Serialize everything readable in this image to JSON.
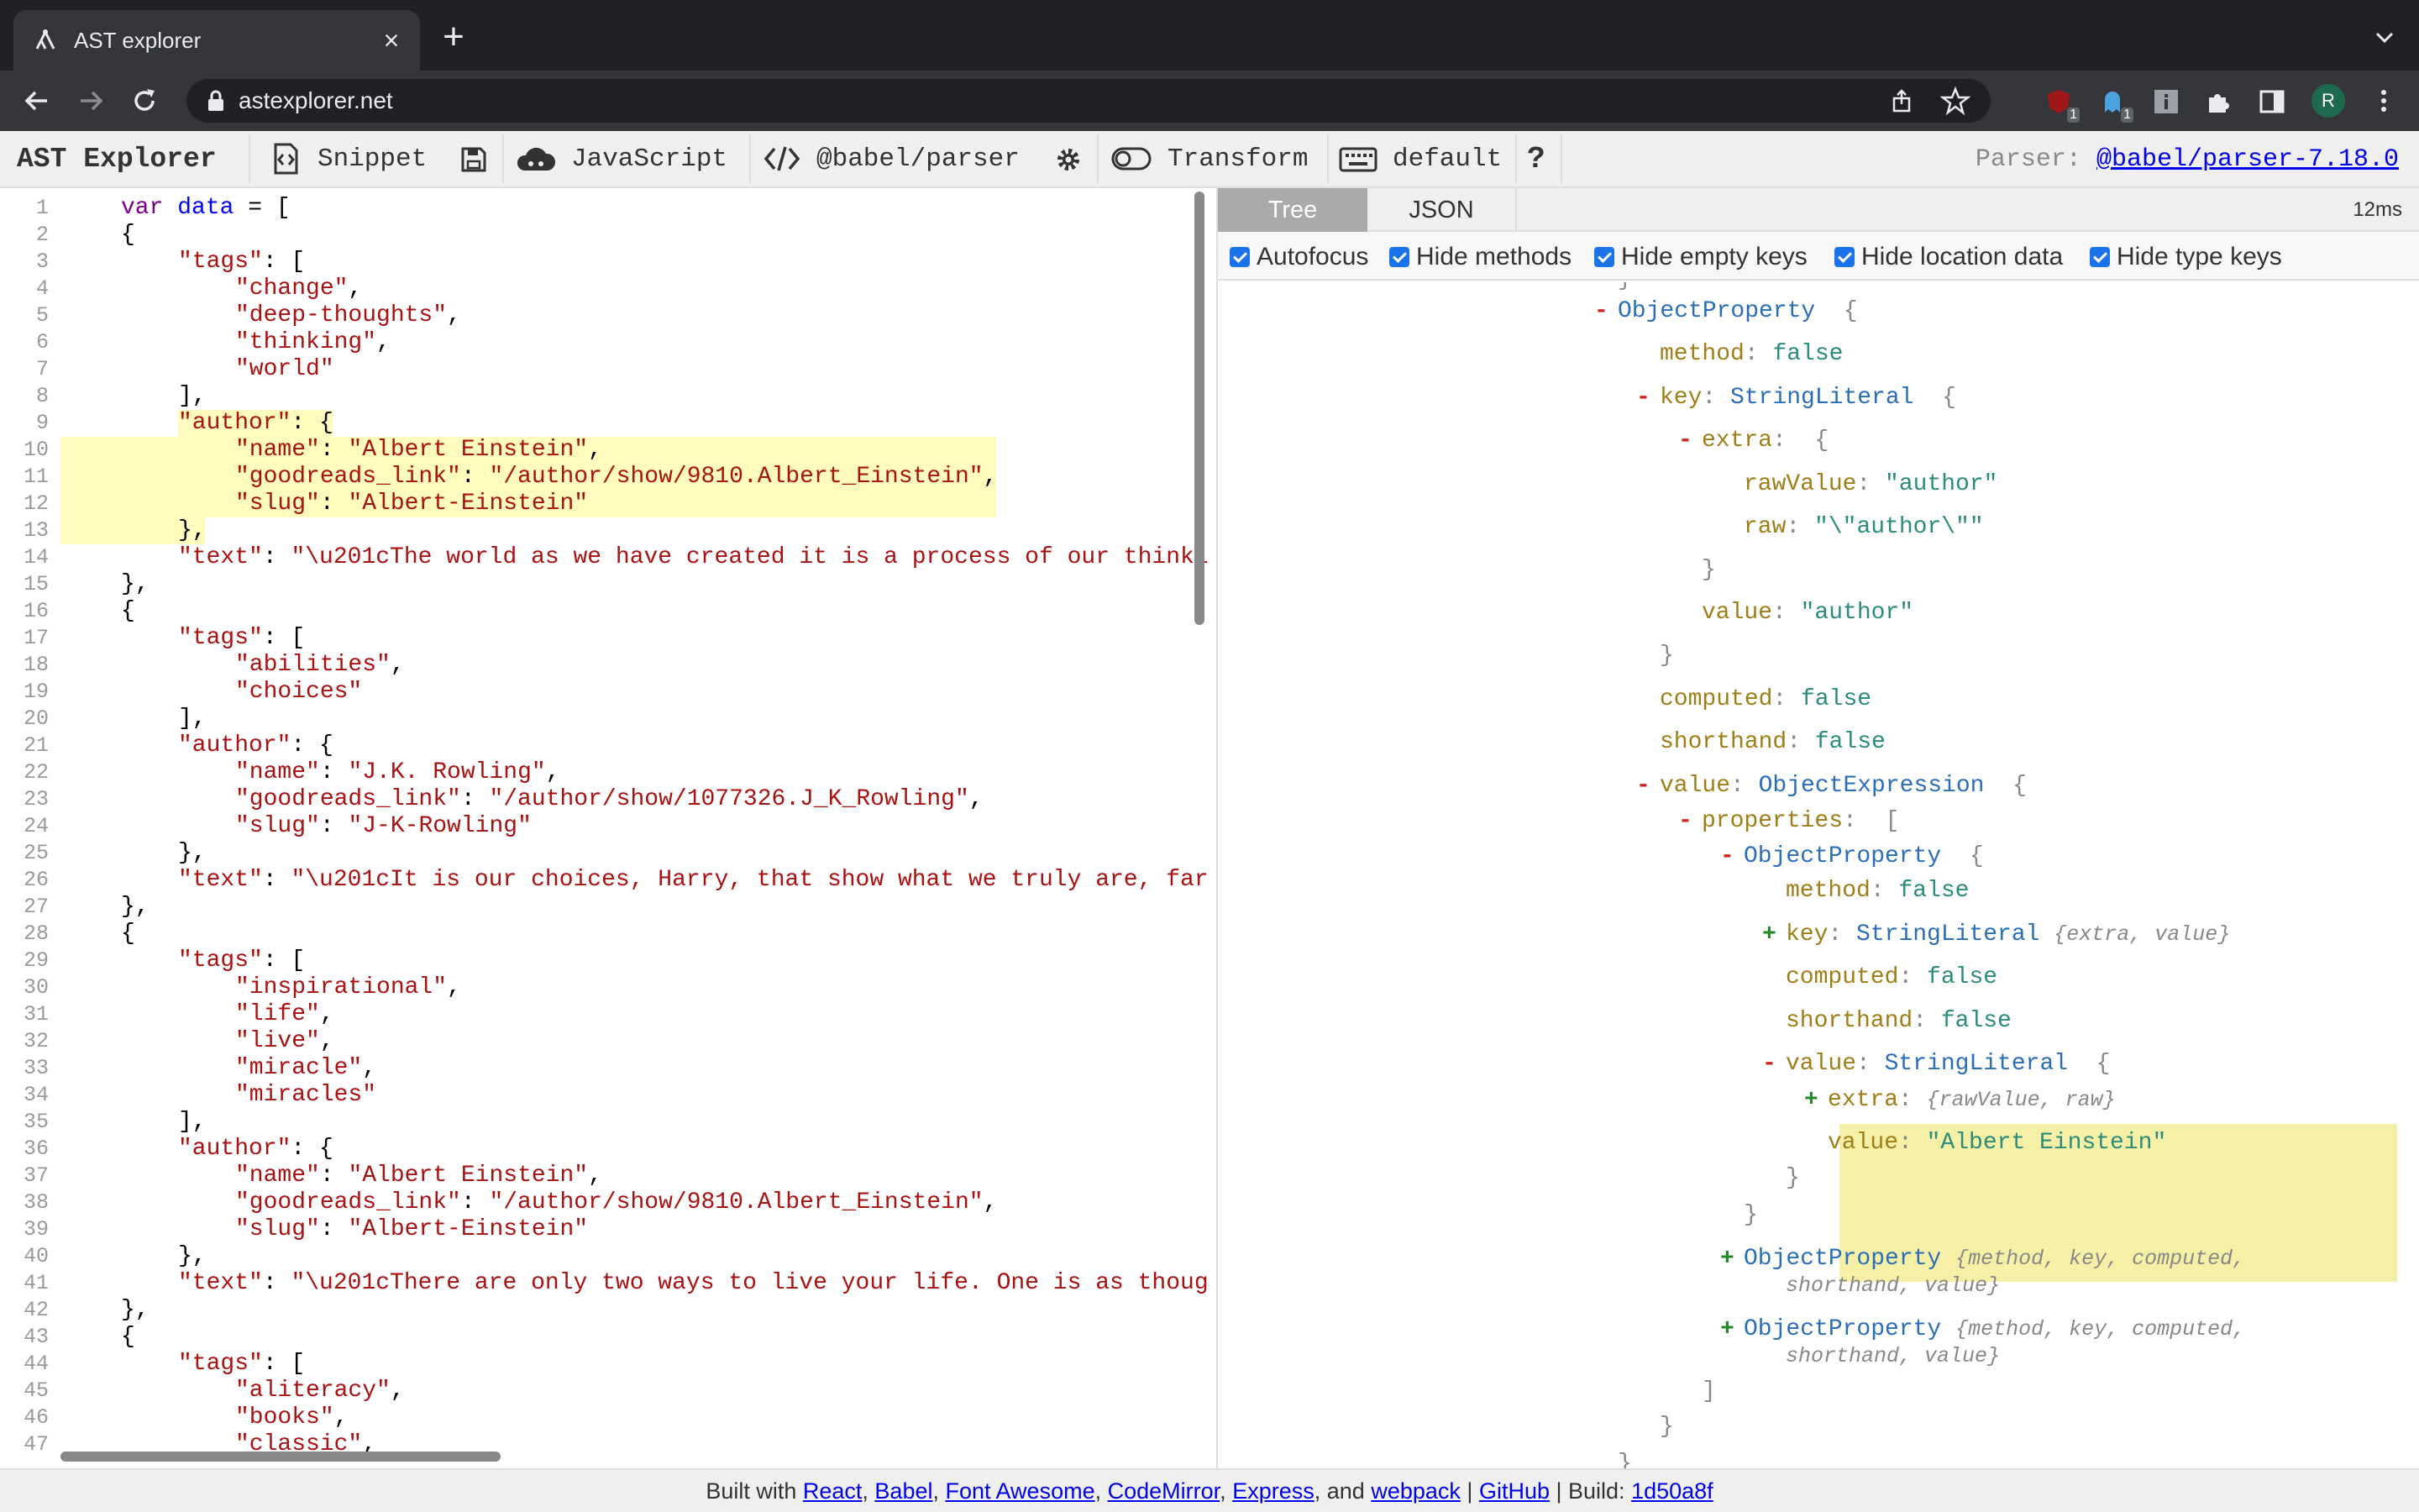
{
  "browser": {
    "tab_title": "AST explorer",
    "url": "astexplorer.net",
    "profile_initial": "R",
    "ext_badges": [
      "1",
      "1"
    ]
  },
  "app": {
    "brand": "AST Explorer",
    "toolbar": {
      "snippet": "Snippet",
      "language": "JavaScript",
      "parser": "@babel/parser",
      "transform": "Transform",
      "keymap": "default",
      "help": "?"
    },
    "parser_label": "Parser:",
    "parser_link": "@babel/parser-7.18.0"
  },
  "editor": {
    "lines": [
      {
        "n": "1",
        "indent": 0,
        "t": [
          [
            "k",
            "var "
          ],
          [
            "v",
            "data"
          ],
          [
            "p",
            " = ["
          ]
        ]
      },
      {
        "n": "2",
        "indent": 0,
        "t": [
          [
            "p",
            "{"
          ]
        ]
      },
      {
        "n": "3",
        "indent": 1,
        "t": [
          [
            "s",
            "\"tags\""
          ],
          [
            "p",
            ": ["
          ]
        ]
      },
      {
        "n": "4",
        "indent": 2,
        "t": [
          [
            "s",
            "\"change\""
          ],
          [
            "p",
            ","
          ]
        ]
      },
      {
        "n": "5",
        "indent": 2,
        "t": [
          [
            "s",
            "\"deep-thoughts\""
          ],
          [
            "p",
            ","
          ]
        ]
      },
      {
        "n": "6",
        "indent": 2,
        "t": [
          [
            "s",
            "\"thinking\""
          ],
          [
            "p",
            ","
          ]
        ]
      },
      {
        "n": "7",
        "indent": 2,
        "t": [
          [
            "s",
            "\"world\""
          ]
        ]
      },
      {
        "n": "8",
        "indent": 1,
        "t": [
          [
            "p",
            "],"
          ]
        ]
      },
      {
        "n": "9",
        "indent": 1,
        "t": [
          [
            "s",
            "\"author\""
          ],
          [
            "p",
            ": {"
          ]
        ]
      },
      {
        "n": "10",
        "indent": 2,
        "t": [
          [
            "s",
            "\"name\""
          ],
          [
            "p",
            ": "
          ],
          [
            "s",
            "\"Albert Einstein\""
          ],
          [
            "p",
            ","
          ]
        ]
      },
      {
        "n": "11",
        "indent": 2,
        "t": [
          [
            "s",
            "\"goodreads_link\""
          ],
          [
            "p",
            ": "
          ],
          [
            "s",
            "\"/author/show/9810.Albert_Einstein\""
          ],
          [
            "p",
            ","
          ]
        ]
      },
      {
        "n": "12",
        "indent": 2,
        "t": [
          [
            "s",
            "\"slug\""
          ],
          [
            "p",
            ": "
          ],
          [
            "s",
            "\"Albert-Einstein\""
          ]
        ]
      },
      {
        "n": "13",
        "indent": 1,
        "t": [
          [
            "p",
            "},"
          ]
        ]
      },
      {
        "n": "14",
        "indent": 1,
        "t": [
          [
            "s",
            "\"text\""
          ],
          [
            "p",
            ": "
          ],
          [
            "s",
            "\"\\u201cThe world as we have created it is a process of our thinki"
          ]
        ]
      },
      {
        "n": "15",
        "indent": 0,
        "t": [
          [
            "p",
            "},"
          ]
        ]
      },
      {
        "n": "16",
        "indent": 0,
        "t": [
          [
            "p",
            "{"
          ]
        ]
      },
      {
        "n": "17",
        "indent": 1,
        "t": [
          [
            "s",
            "\"tags\""
          ],
          [
            "p",
            ": ["
          ]
        ]
      },
      {
        "n": "18",
        "indent": 2,
        "t": [
          [
            "s",
            "\"abilities\""
          ],
          [
            "p",
            ","
          ]
        ]
      },
      {
        "n": "19",
        "indent": 2,
        "t": [
          [
            "s",
            "\"choices\""
          ]
        ]
      },
      {
        "n": "20",
        "indent": 1,
        "t": [
          [
            "p",
            "],"
          ]
        ]
      },
      {
        "n": "21",
        "indent": 1,
        "t": [
          [
            "s",
            "\"author\""
          ],
          [
            "p",
            ": {"
          ]
        ]
      },
      {
        "n": "22",
        "indent": 2,
        "t": [
          [
            "s",
            "\"name\""
          ],
          [
            "p",
            ": "
          ],
          [
            "s",
            "\"J.K. Rowling\""
          ],
          [
            "p",
            ","
          ]
        ]
      },
      {
        "n": "23",
        "indent": 2,
        "t": [
          [
            "s",
            "\"goodreads_link\""
          ],
          [
            "p",
            ": "
          ],
          [
            "s",
            "\"/author/show/1077326.J_K_Rowling\""
          ],
          [
            "p",
            ","
          ]
        ]
      },
      {
        "n": "24",
        "indent": 2,
        "t": [
          [
            "s",
            "\"slug\""
          ],
          [
            "p",
            ": "
          ],
          [
            "s",
            "\"J-K-Rowling\""
          ]
        ]
      },
      {
        "n": "25",
        "indent": 1,
        "t": [
          [
            "p",
            "},"
          ]
        ]
      },
      {
        "n": "26",
        "indent": 1,
        "t": [
          [
            "s",
            "\"text\""
          ],
          [
            "p",
            ": "
          ],
          [
            "s",
            "\"\\u201cIt is our choices, Harry, that show what we truly are, far"
          ]
        ]
      },
      {
        "n": "27",
        "indent": 0,
        "t": [
          [
            "p",
            "},"
          ]
        ]
      },
      {
        "n": "28",
        "indent": 0,
        "t": [
          [
            "p",
            "{"
          ]
        ]
      },
      {
        "n": "29",
        "indent": 1,
        "t": [
          [
            "s",
            "\"tags\""
          ],
          [
            "p",
            ": ["
          ]
        ]
      },
      {
        "n": "30",
        "indent": 2,
        "t": [
          [
            "s",
            "\"inspirational\""
          ],
          [
            "p",
            ","
          ]
        ]
      },
      {
        "n": "31",
        "indent": 2,
        "t": [
          [
            "s",
            "\"life\""
          ],
          [
            "p",
            ","
          ]
        ]
      },
      {
        "n": "32",
        "indent": 2,
        "t": [
          [
            "s",
            "\"live\""
          ],
          [
            "p",
            ","
          ]
        ]
      },
      {
        "n": "33",
        "indent": 2,
        "t": [
          [
            "s",
            "\"miracle\""
          ],
          [
            "p",
            ","
          ]
        ]
      },
      {
        "n": "34",
        "indent": 2,
        "t": [
          [
            "s",
            "\"miracles\""
          ]
        ]
      },
      {
        "n": "35",
        "indent": 1,
        "t": [
          [
            "p",
            "],"
          ]
        ]
      },
      {
        "n": "36",
        "indent": 1,
        "t": [
          [
            "s",
            "\"author\""
          ],
          [
            "p",
            ": {"
          ]
        ]
      },
      {
        "n": "37",
        "indent": 2,
        "t": [
          [
            "s",
            "\"name\""
          ],
          [
            "p",
            ": "
          ],
          [
            "s",
            "\"Albert Einstein\""
          ],
          [
            "p",
            ","
          ]
        ]
      },
      {
        "n": "38",
        "indent": 2,
        "t": [
          [
            "s",
            "\"goodreads_link\""
          ],
          [
            "p",
            ": "
          ],
          [
            "s",
            "\"/author/show/9810.Albert_Einstein\""
          ],
          [
            "p",
            ","
          ]
        ]
      },
      {
        "n": "39",
        "indent": 2,
        "t": [
          [
            "s",
            "\"slug\""
          ],
          [
            "p",
            ": "
          ],
          [
            "s",
            "\"Albert-Einstein\""
          ]
        ]
      },
      {
        "n": "40",
        "indent": 1,
        "t": [
          [
            "p",
            "},"
          ]
        ]
      },
      {
        "n": "41",
        "indent": 1,
        "t": [
          [
            "s",
            "\"text\""
          ],
          [
            "p",
            ": "
          ],
          [
            "s",
            "\"\\u201cThere are only two ways to live your life. One is as thoug"
          ]
        ]
      },
      {
        "n": "42",
        "indent": 0,
        "t": [
          [
            "p",
            "},"
          ]
        ]
      },
      {
        "n": "43",
        "indent": 0,
        "t": [
          [
            "p",
            "{"
          ]
        ]
      },
      {
        "n": "44",
        "indent": 1,
        "t": [
          [
            "s",
            "\"tags\""
          ],
          [
            "p",
            ": ["
          ]
        ]
      },
      {
        "n": "45",
        "indent": 2,
        "t": [
          [
            "s",
            "\"aliteracy\""
          ],
          [
            "p",
            ","
          ]
        ]
      },
      {
        "n": "46",
        "indent": 2,
        "t": [
          [
            "s",
            "\"books\""
          ],
          [
            "p",
            ","
          ]
        ]
      },
      {
        "n": "47",
        "indent": 2,
        "t": [
          [
            "s",
            "\"classic\""
          ],
          [
            "p",
            ","
          ]
        ]
      }
    ]
  },
  "output": {
    "tabs": [
      "Tree",
      "JSON"
    ],
    "active_tab": "Tree",
    "timing": "12ms",
    "options": [
      {
        "label": "Autofocus",
        "checked": true
      },
      {
        "label": "Hide methods",
        "checked": true
      },
      {
        "label": "Hide empty keys",
        "checked": true
      },
      {
        "label": "Hide location data",
        "checked": true
      },
      {
        "label": "Hide type keys",
        "checked": true
      }
    ],
    "tree": [
      {
        "d": 6,
        "tg": "",
        "p": [
          [
            "b",
            "}"
          ]
        ]
      },
      {
        "d": 6,
        "tg": "-",
        "p": [
          [
            "t",
            "ObjectProperty"
          ],
          [
            "b",
            "  {"
          ]
        ]
      },
      {
        "d": 7,
        "tg": "",
        "p": [
          [
            "k",
            "method"
          ],
          [
            "b",
            ": "
          ],
          [
            "o",
            "false"
          ]
        ]
      },
      {
        "d": 7,
        "tg": "-",
        "p": [
          [
            "k",
            "key"
          ],
          [
            "b",
            ": "
          ],
          [
            "t",
            "StringLiteral"
          ],
          [
            "b",
            "  {"
          ]
        ]
      },
      {
        "d": 8,
        "tg": "-",
        "p": [
          [
            "k",
            "extra"
          ],
          [
            "b",
            ":  {"
          ]
        ]
      },
      {
        "d": 9,
        "tg": "",
        "p": [
          [
            "k",
            "rawValue"
          ],
          [
            "b",
            ": "
          ],
          [
            "q",
            "\"author\""
          ]
        ]
      },
      {
        "d": 9,
        "tg": "",
        "p": [
          [
            "k",
            "raw"
          ],
          [
            "b",
            ": "
          ],
          [
            "q",
            "\"\\\"author\\\"\""
          ]
        ]
      },
      {
        "d": 8,
        "tg": "",
        "p": [
          [
            "b",
            "}"
          ]
        ]
      },
      {
        "d": 8,
        "tg": "",
        "p": [
          [
            "k",
            "value"
          ],
          [
            "b",
            ": "
          ],
          [
            "q",
            "\"author\""
          ]
        ]
      },
      {
        "d": 7,
        "tg": "",
        "p": [
          [
            "b",
            "}"
          ]
        ]
      },
      {
        "d": 7,
        "tg": "",
        "p": [
          [
            "k",
            "computed"
          ],
          [
            "b",
            ": "
          ],
          [
            "o",
            "false"
          ]
        ]
      },
      {
        "d": 7,
        "tg": "",
        "p": [
          [
            "k",
            "shorthand"
          ],
          [
            "b",
            ": "
          ],
          [
            "o",
            "false"
          ]
        ]
      },
      {
        "d": 7,
        "tg": "-",
        "p": [
          [
            "k",
            "value"
          ],
          [
            "b",
            ": "
          ],
          [
            "t",
            "ObjectExpression"
          ],
          [
            "b",
            "  {"
          ]
        ]
      },
      {
        "d": 8,
        "tg": "-",
        "p": [
          [
            "k",
            "properties"
          ],
          [
            "b",
            ":  ["
          ]
        ]
      },
      {
        "d": 9,
        "tg": "-",
        "p": [
          [
            "t",
            "ObjectProperty"
          ],
          [
            "b",
            "  {"
          ]
        ]
      },
      {
        "d": 10,
        "tg": "",
        "p": [
          [
            "k",
            "method"
          ],
          [
            "b",
            ": "
          ],
          [
            "o",
            "false"
          ]
        ]
      },
      {
        "d": 10,
        "tg": "+",
        "p": [
          [
            "k",
            "key"
          ],
          [
            "b",
            ": "
          ],
          [
            "t",
            "StringLiteral"
          ],
          [
            "b",
            " "
          ],
          [
            "m",
            "{extra, value}"
          ]
        ]
      },
      {
        "d": 10,
        "tg": "",
        "p": [
          [
            "k",
            "computed"
          ],
          [
            "b",
            ": "
          ],
          [
            "o",
            "false"
          ]
        ]
      },
      {
        "d": 10,
        "tg": "",
        "p": [
          [
            "k",
            "shorthand"
          ],
          [
            "b",
            ": "
          ],
          [
            "o",
            "false"
          ]
        ]
      },
      {
        "d": 10,
        "tg": "-",
        "p": [
          [
            "k",
            "value"
          ],
          [
            "b",
            ": "
          ],
          [
            "t",
            "StringLiteral"
          ],
          [
            "b",
            "  {"
          ]
        ]
      },
      {
        "d": 11,
        "tg": "+",
        "p": [
          [
            "k",
            "extra"
          ],
          [
            "b",
            ": "
          ],
          [
            "m",
            "{rawValue, raw}"
          ]
        ]
      },
      {
        "d": 11,
        "tg": "",
        "p": [
          [
            "k",
            "value"
          ],
          [
            "b",
            ": "
          ],
          [
            "q",
            "\"Albert Einstein\""
          ]
        ]
      },
      {
        "d": 10,
        "tg": "",
        "p": [
          [
            "b",
            "}"
          ]
        ]
      },
      {
        "d": 9,
        "tg": "",
        "p": [
          [
            "b",
            "}"
          ]
        ]
      },
      {
        "d": 9,
        "tg": "+",
        "p": [
          [
            "t",
            "ObjectProperty"
          ],
          [
            "b",
            " "
          ],
          [
            "m",
            "{method, key, computed,"
          ]
        ]
      },
      {
        "d": 10,
        "tg": "",
        "p": [
          [
            "m",
            "shorthand, value}"
          ]
        ]
      },
      {
        "d": 9,
        "tg": "+",
        "p": [
          [
            "t",
            "ObjectProperty"
          ],
          [
            "b",
            " "
          ],
          [
            "m",
            "{method, key, computed,"
          ]
        ]
      },
      {
        "d": 10,
        "tg": "",
        "p": [
          [
            "m",
            "shorthand, value}"
          ]
        ]
      },
      {
        "d": 8,
        "tg": "",
        "p": [
          [
            "b",
            "]"
          ]
        ]
      },
      {
        "d": 7,
        "tg": "",
        "p": [
          [
            "b",
            "}"
          ]
        ]
      },
      {
        "d": 6,
        "tg": "",
        "p": [
          [
            "b",
            "}"
          ]
        ]
      }
    ]
  },
  "footer": {
    "prefix": "Built with ",
    "links": [
      "React",
      "Babel",
      "Font Awesome",
      "CodeMirror",
      "Express",
      "webpack"
    ],
    "and": "and",
    "github": "GitHub",
    "build_label": "Build:",
    "build_hash": "1d50a8f"
  }
}
